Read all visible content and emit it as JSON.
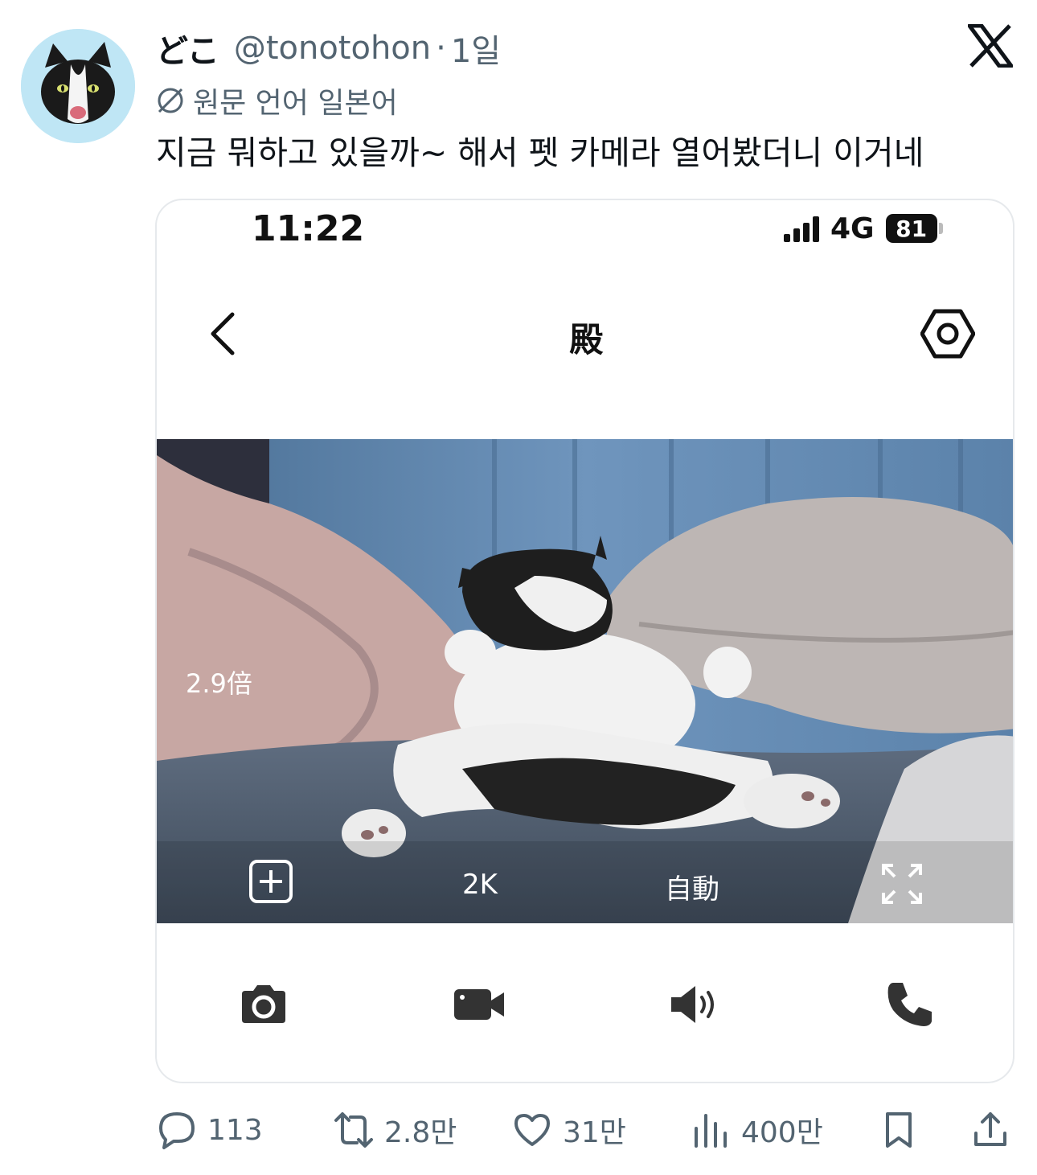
{
  "user": {
    "display_name": "どこ",
    "handle": "@tonotohon",
    "separator": "·",
    "time": "1일",
    "avatar_icon": "cat-avatar-icon"
  },
  "translation": {
    "label": "원문 언어 일본어",
    "icon": "translate-icon"
  },
  "tweet": {
    "text": "지금 뭐하고 있을까~ 해서 펫 카메라 열어봤더니 이거네"
  },
  "phone_status": {
    "time": "11:22",
    "network": "4G",
    "battery": "81"
  },
  "app": {
    "title": "殿",
    "zoom": "2.9倍",
    "resolution": "2K",
    "mode": "自動"
  },
  "actions": {
    "replies": "113",
    "reposts": "2.8만",
    "likes": "31만",
    "views": "400만"
  },
  "colors": {
    "text": "#0f1419",
    "secondary": "#536471",
    "border": "#e6e9ec",
    "avatar_bg": "#bfe6f5"
  }
}
